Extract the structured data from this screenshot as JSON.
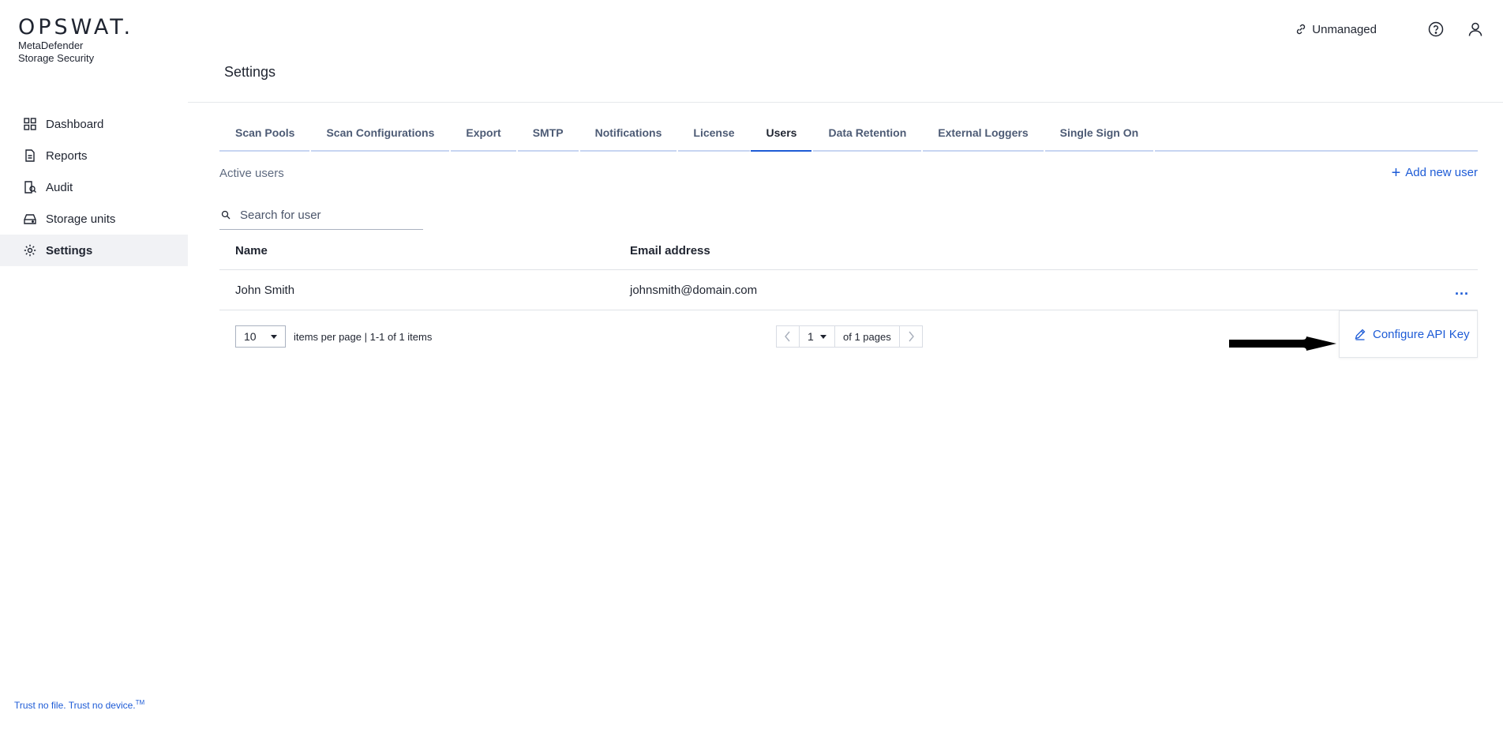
{
  "brand": {
    "logo": "OPSWAT.",
    "product_line1": "MetaDefender",
    "product_line2": "Storage Security"
  },
  "sidebar": {
    "items": [
      {
        "label": "Dashboard",
        "icon": "dashboard-icon"
      },
      {
        "label": "Reports",
        "icon": "report-icon"
      },
      {
        "label": "Audit",
        "icon": "audit-icon"
      },
      {
        "label": "Storage units",
        "icon": "storage-icon"
      },
      {
        "label": "Settings",
        "icon": "gear-icon",
        "active": true
      }
    ],
    "tagline": "Trust no file. Trust no device.",
    "tagline_mark": "TM"
  },
  "topbar": {
    "unmanaged": "Unmanaged",
    "help_icon": "help-icon",
    "user_icon": "user-icon"
  },
  "page": {
    "title": "Settings"
  },
  "tabs": [
    {
      "label": "Scan Pools"
    },
    {
      "label": "Scan Configurations"
    },
    {
      "label": "Export"
    },
    {
      "label": "SMTP"
    },
    {
      "label": "Notifications"
    },
    {
      "label": "License"
    },
    {
      "label": "Users",
      "active": true
    },
    {
      "label": "Data Retention"
    },
    {
      "label": "External Loggers"
    },
    {
      "label": "Single Sign On"
    }
  ],
  "users": {
    "section_label": "Active users",
    "add_user": "Add new user",
    "search_placeholder": "Search for user",
    "columns": {
      "name": "Name",
      "email": "Email address"
    },
    "rows": [
      {
        "name": "John Smith",
        "email": "johnsmith@domain.com",
        "actions": "..."
      }
    ],
    "pagination": {
      "page_size": "10",
      "items_text": "items per page | 1-1 of 1 items",
      "current_page": "1",
      "pages_text": "of 1 pages"
    },
    "row_menu": {
      "configure_api_key": "Configure API Key"
    }
  },
  "colors": {
    "accent": "#1d5bd6",
    "text": "#1f2430",
    "muted": "#4d5b75"
  }
}
